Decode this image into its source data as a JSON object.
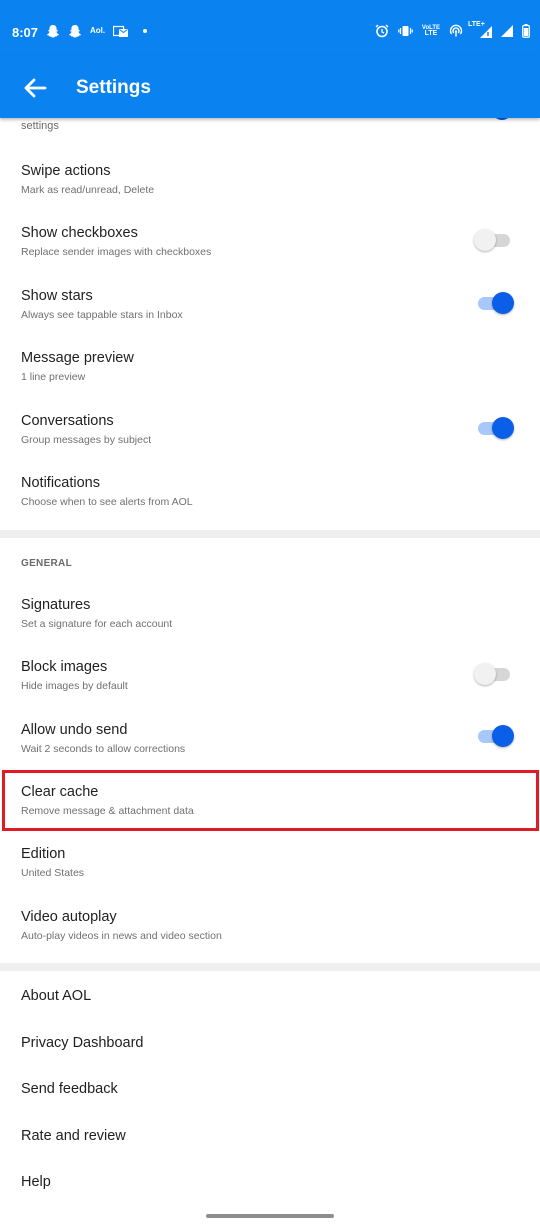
{
  "status_bar": {
    "time": "8:07",
    "left_icons": [
      "snapchat-icon",
      "snapchat-icon",
      "aol-icon",
      "mail-icon",
      "dot-icon"
    ],
    "aol_text": "Aol.",
    "right_icons": [
      "alarm-icon",
      "vibrate-icon",
      "volte-icon",
      "hotspot-icon",
      "lte-signal-icon",
      "signal-icon",
      "battery-icon"
    ],
    "volte_text_top": "VoLTE",
    "volte_text_bottom": "LTE",
    "lte_plus_text": "LTE+"
  },
  "app_bar": {
    "title": "Settings",
    "back_icon": "arrow-left-icon"
  },
  "partial_item": {
    "subtitle": "settings",
    "toggle_on": true
  },
  "mail_settings": [
    {
      "title": "Swipe actions",
      "subtitle": "Mark as read/unread, Delete"
    },
    {
      "title": "Show checkboxes",
      "subtitle": "Replace sender images with checkboxes",
      "toggle": false
    },
    {
      "title": "Show stars",
      "subtitle": "Always see tappable stars in Inbox",
      "toggle": true
    },
    {
      "title": "Message preview",
      "subtitle": "1 line preview"
    },
    {
      "title": "Conversations",
      "subtitle": "Group messages by subject",
      "toggle": true
    },
    {
      "title": "Notifications",
      "subtitle": "Choose when to see alerts from AOL"
    }
  ],
  "general": {
    "header": "GENERAL",
    "items": [
      {
        "title": "Signatures",
        "subtitle": "Set a signature for each account"
      },
      {
        "title": "Block images",
        "subtitle": "Hide images by default",
        "toggle": false
      },
      {
        "title": "Allow undo send",
        "subtitle": "Wait 2 seconds to allow corrections",
        "toggle": true
      },
      {
        "title": "Clear cache",
        "subtitle": "Remove message & attachment data",
        "highlighted": true
      },
      {
        "title": "Edition",
        "subtitle": "United States"
      },
      {
        "title": "Video autoplay",
        "subtitle": "Auto-play videos in news and video section"
      }
    ]
  },
  "about": {
    "items": [
      {
        "title": "About AOL"
      },
      {
        "title": "Privacy Dashboard"
      },
      {
        "title": "Send feedback"
      },
      {
        "title": "Rate and review"
      },
      {
        "title": "Help"
      }
    ]
  },
  "colors": {
    "primary": "#0a83f0",
    "toggle_on_knob": "#0a5ee8",
    "toggle_on_track": "#a8c8fb",
    "highlight_border": "#e01b24"
  }
}
